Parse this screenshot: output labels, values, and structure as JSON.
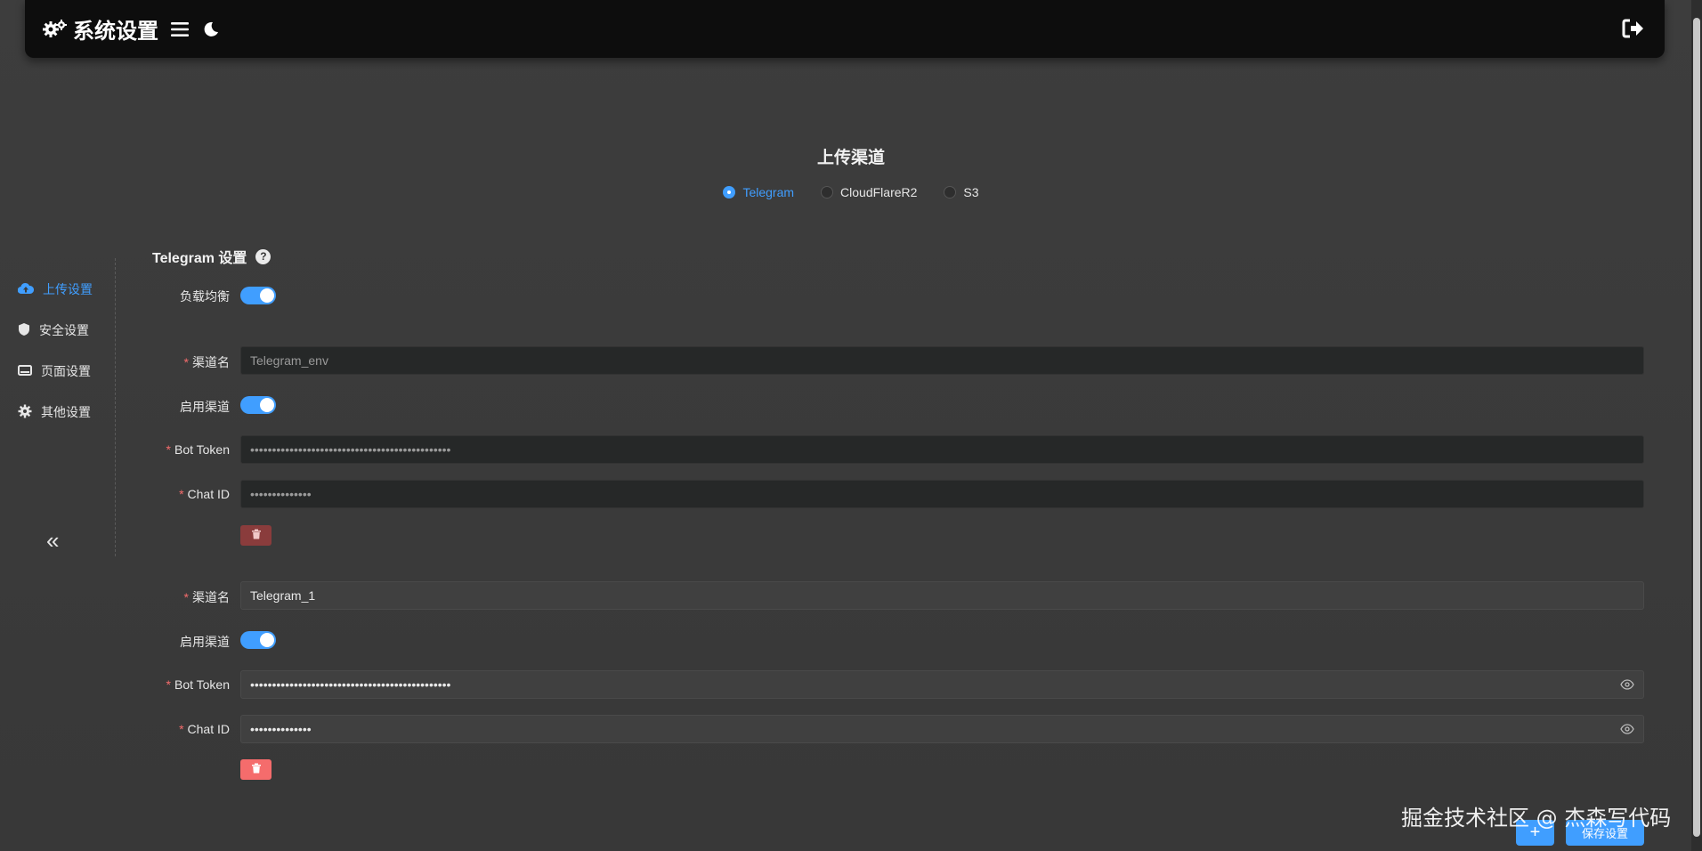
{
  "header": {
    "title": "系统设置",
    "icons": [
      "gears-icon",
      "menu-icon",
      "moon-icon",
      "logout-icon"
    ]
  },
  "upload_channel": {
    "title": "上传渠道",
    "options": [
      {
        "label": "Telegram",
        "selected": true
      },
      {
        "label": "CloudFlareR2",
        "selected": false
      },
      {
        "label": "S3",
        "selected": false
      }
    ]
  },
  "sidebar": {
    "items": [
      {
        "label": "上传设置",
        "icon": "cloud-upload-icon",
        "active": true
      },
      {
        "label": "安全设置",
        "icon": "shield-icon",
        "active": false
      },
      {
        "label": "页面设置",
        "icon": "display-icon",
        "active": false
      },
      {
        "label": "其他设置",
        "icon": "gear-icon",
        "active": false
      }
    ],
    "collapse_label": "«"
  },
  "form": {
    "title": "Telegram 设置",
    "help_icon": "?",
    "load_balance_label": "负载均衡",
    "load_balance_on": true,
    "channels": [
      {
        "name_label": "渠道名",
        "name_value": "Telegram_env",
        "enable_label": "启用渠道",
        "enabled": true,
        "token_label": "Bot Token",
        "token_value": "••••••••••••••••••••••••••••••••••••••••••••••",
        "chat_label": "Chat ID",
        "chat_value": "••••••••••••••",
        "disabled": true
      },
      {
        "name_label": "渠道名",
        "name_value": "Telegram_1",
        "enable_label": "启用渠道",
        "enabled": true,
        "token_label": "Bot Token",
        "token_value": "••••••••••••••••••••••••••••••••••••••••••••••",
        "chat_label": "Chat ID",
        "chat_value": "••••••••••••••",
        "disabled": false
      }
    ]
  },
  "actions": {
    "add_label": "+",
    "save_label": "保存设置"
  },
  "watermark": "掘金技术社区 @ 杰森写代码",
  "colors": {
    "accent": "#409eff",
    "danger": "#f56c6c",
    "header_bg": "#0d0d0d",
    "page_bg": "#3b3b3b"
  }
}
